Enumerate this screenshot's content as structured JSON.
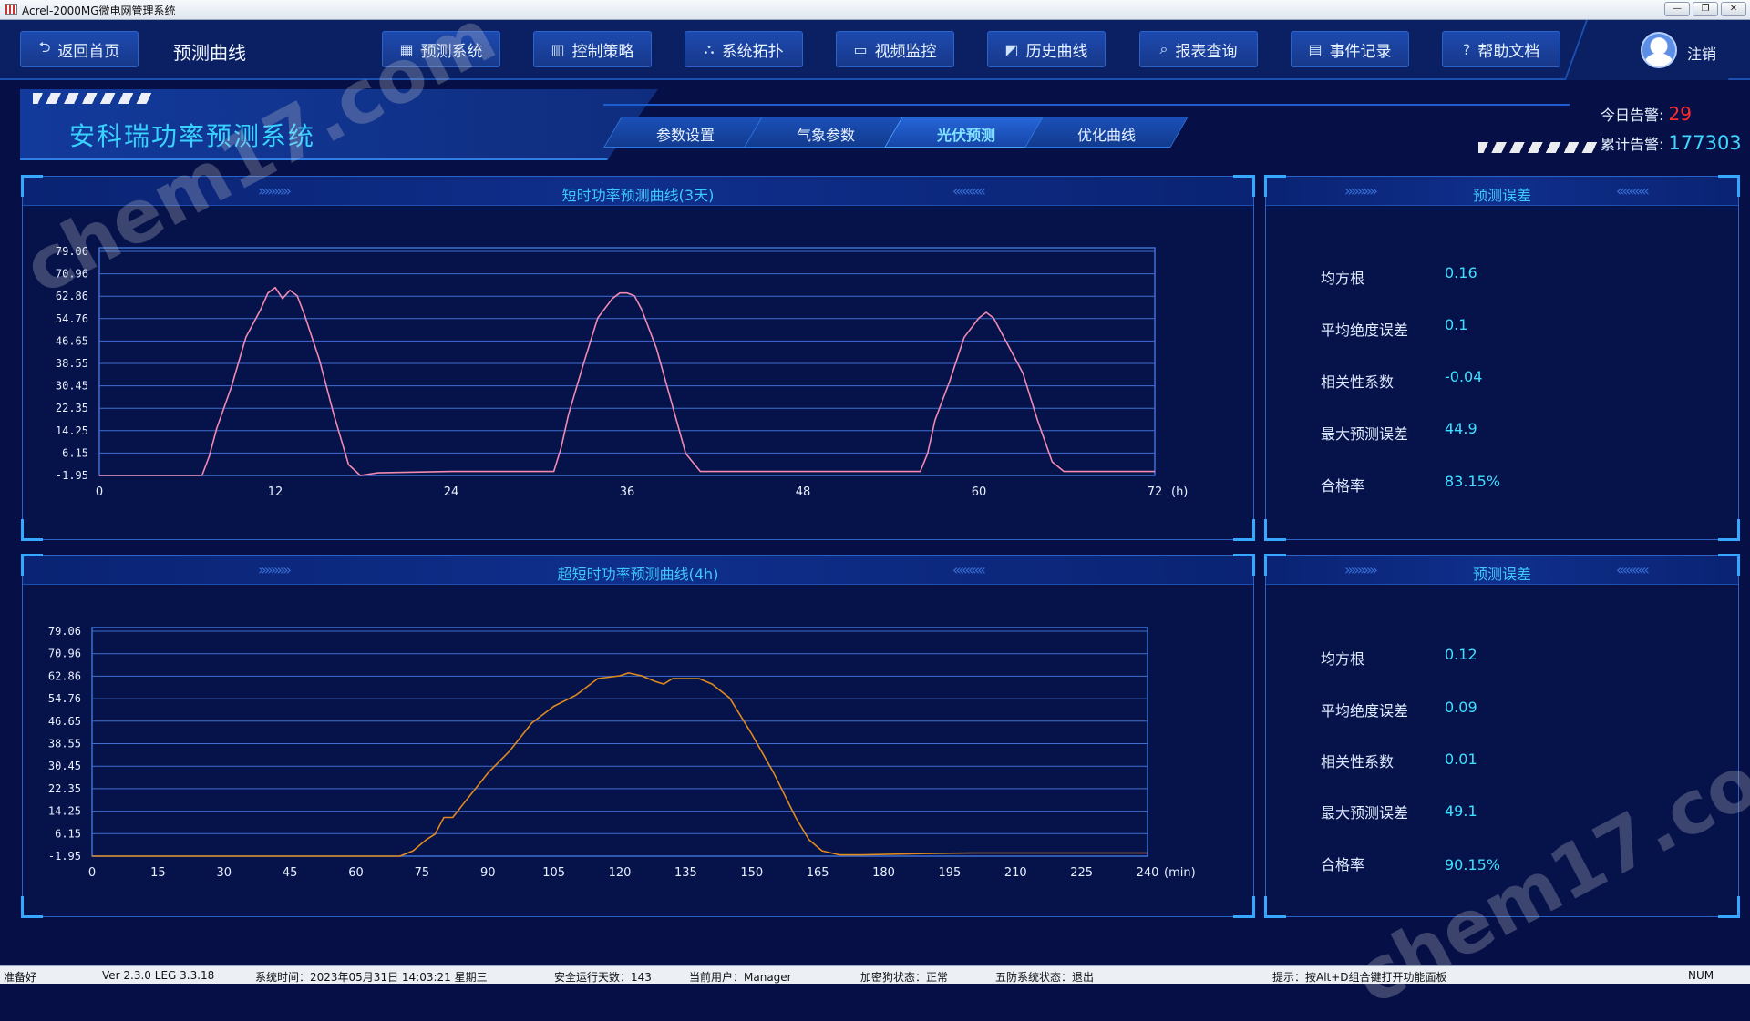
{
  "window": {
    "title": "Acrel-2000MG微电网管理系统",
    "buttons": [
      "—",
      "❐",
      "✕"
    ]
  },
  "nav": {
    "back_label": "返回首页",
    "page_title": "预测曲线",
    "items": [
      {
        "label": "预测系统",
        "icon": "grid-icon"
      },
      {
        "label": "控制策略",
        "icon": "sliders-icon"
      },
      {
        "label": "系统拓扑",
        "icon": "topology-icon"
      },
      {
        "label": "视频监控",
        "icon": "camera-icon"
      },
      {
        "label": "历史曲线",
        "icon": "chart-icon"
      },
      {
        "label": "报表查询",
        "icon": "search-icon"
      },
      {
        "label": "事件记录",
        "icon": "document-icon"
      },
      {
        "label": "帮助文档",
        "icon": "help-icon"
      }
    ],
    "logout_label": "注销"
  },
  "banner": {
    "title": "安科瑞功率预测系统",
    "tabs": [
      {
        "label": "参数设置",
        "active": false
      },
      {
        "label": "气象参数",
        "active": false
      },
      {
        "label": "光伏预测",
        "active": true
      },
      {
        "label": "优化曲线",
        "active": false
      }
    ],
    "alarm_today_label": "今日告警:",
    "alarm_today_value": "29",
    "alarm_total_label": "累计告警:",
    "alarm_total_value": "177303"
  },
  "short_panel": {
    "title": "短时功率预测曲线(3天)",
    "stats_title": "预测误差",
    "stats": [
      {
        "label": "均方根",
        "value": "0.16"
      },
      {
        "label": "平均绝度误差",
        "value": "0.1"
      },
      {
        "label": "相关性系数",
        "value": "-0.04"
      },
      {
        "label": "最大预测误差",
        "value": "44.9"
      },
      {
        "label": "合格率",
        "value": "83.15%"
      }
    ]
  },
  "ultra_panel": {
    "title": "超短时功率预测曲线(4h)",
    "stats_title": "预测误差",
    "stats": [
      {
        "label": "均方根",
        "value": "0.12"
      },
      {
        "label": "平均绝度误差",
        "value": "0.09"
      },
      {
        "label": "相关性系数",
        "value": "0.01"
      },
      {
        "label": "最大预测误差",
        "value": "49.1"
      },
      {
        "label": "合格率",
        "value": "90.15%"
      }
    ]
  },
  "chart_data": [
    {
      "type": "line",
      "title": "短时功率预测曲线(3天)",
      "xlabel": "(h)",
      "xlim": [
        0,
        72
      ],
      "ylim": [
        -1.95,
        79.06
      ],
      "xticks": [
        "0",
        "12",
        "24",
        "36",
        "48",
        "60",
        "72"
      ],
      "yticks": [
        "79.06",
        "70.96",
        "62.86",
        "54.76",
        "46.65",
        "38.55",
        "30.45",
        "22.35",
        "14.25",
        "6.15",
        "-1.95"
      ],
      "color": "#f08ab0",
      "series": [
        {
          "x": [
            0,
            7,
            7.5,
            8,
            9,
            10,
            11,
            11.5,
            12,
            12.5,
            13,
            13.5,
            14,
            15,
            16,
            17,
            17.8,
            19,
            24,
            31,
            31.5,
            32,
            33,
            34,
            35,
            35.5,
            36,
            36.5,
            37,
            38,
            39,
            40,
            41,
            41.8,
            48,
            56,
            56.5,
            57,
            58,
            59,
            60,
            60.5,
            61,
            62,
            63,
            64,
            65,
            65.8,
            72
          ],
          "y": [
            -1.95,
            -1.95,
            5,
            15,
            30,
            48,
            58,
            64,
            66,
            62,
            65,
            63,
            56,
            40,
            20,
            2,
            -1.95,
            -1,
            -0.5,
            -0.5,
            8,
            20,
            38,
            55,
            62,
            64,
            64,
            63,
            58,
            44,
            25,
            6,
            -0.5,
            -0.5,
            -0.5,
            -0.5,
            6,
            18,
            32,
            48,
            55,
            57,
            55,
            45,
            35,
            18,
            3,
            -0.5,
            -0.5
          ]
        }
      ]
    },
    {
      "type": "line",
      "title": "超短时功率预测曲线(4h)",
      "xlabel": "(min)",
      "xlim": [
        0,
        240
      ],
      "ylim": [
        -1.95,
        79.06
      ],
      "xticks": [
        "0",
        "15",
        "30",
        "45",
        "60",
        "75",
        "90",
        "105",
        "120",
        "135",
        "150",
        "165",
        "180",
        "195",
        "210",
        "225",
        "240"
      ],
      "yticks": [
        "79.06",
        "70.96",
        "62.86",
        "54.76",
        "46.65",
        "38.55",
        "30.45",
        "22.35",
        "14.25",
        "6.15",
        "-1.95"
      ],
      "color": "#e08a1e",
      "series": [
        {
          "x": [
            0,
            70,
            73,
            76,
            78,
            80,
            82,
            85,
            90,
            95,
            100,
            105,
            110,
            115,
            120,
            122,
            125,
            128,
            130,
            132,
            135,
            138,
            141,
            145,
            150,
            155,
            160,
            163,
            166,
            170,
            175,
            190,
            200,
            240
          ],
          "y": [
            -1.95,
            -1.95,
            0,
            4,
            6,
            12,
            12,
            18,
            28,
            36,
            46,
            52,
            56,
            62,
            63,
            64,
            63,
            61,
            60,
            62,
            62,
            62,
            60,
            55,
            42,
            28,
            12,
            4,
            0,
            -1.5,
            -1.5,
            -1,
            -0.8,
            -0.8
          ]
        }
      ]
    }
  ],
  "statusbar": {
    "ready": "准备好",
    "version": "Ver 2.3.0 LEG 3.3.18",
    "system_time": "系统时间：2023年05月31日  14:03:21   星期三",
    "run_days": "安全运行天数：143",
    "current_user": "当前用户：Manager",
    "dongle": "加密狗状态：正常",
    "five_defense": "五防系统状态：退出",
    "hint": "提示：按Alt+D组合键打开功能面板",
    "num": "NUM"
  },
  "watermark": "chem17.com",
  "colors": {
    "background": "#061046",
    "accent_cyan": "#3fd6ff",
    "alarm_red": "#ff2e2e",
    "nav_blue": "#1d4ab0"
  }
}
